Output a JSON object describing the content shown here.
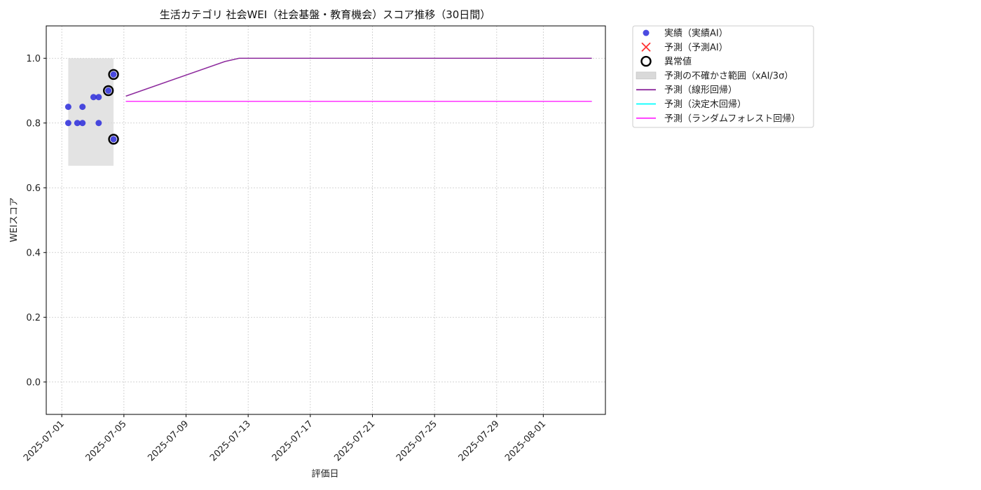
{
  "chart_data": {
    "type": "scatter",
    "title": "生活カテゴリ 社会WEI（社会基盤・教育機会）スコア推移（30日間）",
    "xlabel": "評価日",
    "ylabel": "WEIスコア",
    "xlim": [
      "2025-06-30",
      "2025-08-05"
    ],
    "ylim": [
      -0.1,
      1.1
    ],
    "grid": true,
    "legend_position": "outside-right-top",
    "x_ticks": [
      "2025-07-01",
      "2025-07-05",
      "2025-07-09",
      "2025-07-13",
      "2025-07-17",
      "2025-07-21",
      "2025-07-25",
      "2025-07-29",
      "2025-08-01"
    ],
    "y_ticks": [
      "0.0",
      "0.2",
      "0.4",
      "0.6",
      "0.8",
      "1.0"
    ],
    "colors": {
      "actual": "#2b2bdc",
      "predicted_ai": "#ff3333",
      "anomaly": "#000000",
      "uncertainty": "#d9d9d9",
      "linear": "#8e2c9e",
      "decision_tree": "#00ffff",
      "random_forest": "#ff33ff"
    },
    "uncertainty_band": {
      "x_start": "2025-07-01 10:00",
      "x_end": "2025-07-04 08:00",
      "y_low": 0.668,
      "y_high": 1.0
    },
    "series": [
      {
        "name": "実績（実績AI）",
        "kind": "scatter",
        "points": [
          {
            "x": "2025-07-01 10:00",
            "y": 0.85
          },
          {
            "x": "2025-07-01 10:00",
            "y": 0.8
          },
          {
            "x": "2025-07-02 00:00",
            "y": 0.8
          },
          {
            "x": "2025-07-02 08:00",
            "y": 0.85
          },
          {
            "x": "2025-07-02 08:00",
            "y": 0.8
          },
          {
            "x": "2025-07-03 01:00",
            "y": 0.88
          },
          {
            "x": "2025-07-03 09:00",
            "y": 0.88
          },
          {
            "x": "2025-07-03 09:00",
            "y": 0.8
          },
          {
            "x": "2025-07-04 00:00",
            "y": 0.9
          },
          {
            "x": "2025-07-04 08:00",
            "y": 0.95
          },
          {
            "x": "2025-07-04 08:00",
            "y": 0.75
          }
        ]
      },
      {
        "name": "予測（予測AI）",
        "kind": "x-marker",
        "points": []
      },
      {
        "name": "異常値",
        "kind": "ring",
        "points": [
          {
            "x": "2025-07-04 00:00",
            "y": 0.9
          },
          {
            "x": "2025-07-04 08:00",
            "y": 0.95
          },
          {
            "x": "2025-07-04 08:00",
            "y": 0.75
          }
        ]
      },
      {
        "name": "予測の不確かさ範囲（xAI/3σ）",
        "kind": "band",
        "points": []
      },
      {
        "name": "予測（線形回帰）",
        "kind": "line",
        "points": [
          {
            "x": "2025-07-05 03:00",
            "y": 0.883
          },
          {
            "x": "2025-07-11 12:00",
            "y": 0.99
          },
          {
            "x": "2025-07-12 10:00",
            "y": 1.0
          },
          {
            "x": "2025-08-04 03:00",
            "y": 1.0
          }
        ]
      },
      {
        "name": "予測（決定木回帰）",
        "kind": "line",
        "points": [
          {
            "x": "2025-07-05 03:00",
            "y": 0.867
          },
          {
            "x": "2025-08-04 03:00",
            "y": 0.867
          }
        ]
      },
      {
        "name": "予測（ランダムフォレスト回帰）",
        "kind": "line",
        "points": [
          {
            "x": "2025-07-05 03:00",
            "y": 0.867
          },
          {
            "x": "2025-08-04 03:00",
            "y": 0.867
          }
        ]
      }
    ]
  }
}
